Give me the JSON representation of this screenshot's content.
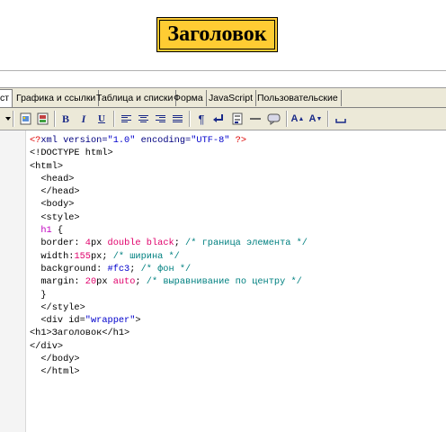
{
  "preview": {
    "heading": "Заголовок"
  },
  "tabs": [
    {
      "label": "ст"
    },
    {
      "label": "Графика и ссылки"
    },
    {
      "label": "Таблица и списки"
    },
    {
      "label": "Форма"
    },
    {
      "label": "JavaScript"
    },
    {
      "label": "Пользовательские"
    }
  ],
  "toolbar": {
    "icons": [
      "dropdown-arrow-icon",
      "insert-image-icon",
      "insert-media-icon",
      "bold-icon",
      "italic-icon",
      "underline-icon",
      "align-left-icon",
      "align-center-icon",
      "align-right-icon",
      "align-justify-icon",
      "paragraph-icon",
      "line-break-icon",
      "form-icon",
      "horizontal-rule-icon",
      "comment-icon",
      "font-larger-icon",
      "font-smaller-icon",
      "nbsp-icon"
    ],
    "bold_label": "B",
    "italic_label": "I",
    "underline_label": "U",
    "paragraph_label": "¶",
    "font_up_label": "A",
    "font_down_label": "A"
  },
  "code": {
    "lines": [
      "<?xml version=\"1.0\" encoding=\"UTF-8\" ?>",
      "<!DOCTYPE html>",
      "<html>",
      "  <head>",
      "  </head>",
      "  <body>",
      "  <style>",
      "  h1 {",
      "  border: 4px double black; /* граница элемента */",
      "  width:155px; /* ширина */",
      "  background: #fc3; /* фон */",
      "  margin: 20px auto; /* выравнивание по центру */",
      "  }",
      "  </style>",
      "  <div id=\"wrapper\">",
      "<h1>Заголовок</h1>",
      "</div>",
      "  </body>",
      "  </html>"
    ]
  },
  "colors": {
    "heading_bg": "#ffcc33",
    "frame_bg": "#ece9d8",
    "comment": "#008080",
    "number": "#e0006b",
    "string": "#0000cc"
  }
}
